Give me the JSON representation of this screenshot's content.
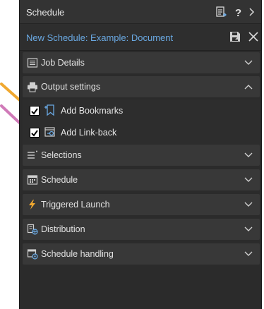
{
  "header": {
    "title": "Schedule"
  },
  "schedule": {
    "name": "New Schedule: Example: Document"
  },
  "sections": [
    {
      "label": "Job Details",
      "expanded": false,
      "icon": "list-icon"
    },
    {
      "label": "Output settings",
      "expanded": true,
      "icon": "printer-icon"
    },
    {
      "label": "Selections",
      "expanded": false,
      "icon": "selection-list-icon"
    },
    {
      "label": "Schedule",
      "expanded": false,
      "icon": "calendar-icon"
    },
    {
      "label": "Triggered Launch",
      "expanded": false,
      "icon": "lightning-icon"
    },
    {
      "label": "Distribution",
      "expanded": false,
      "icon": "distribution-icon"
    },
    {
      "label": "Schedule handling",
      "expanded": false,
      "icon": "schedule-handling-icon"
    }
  ],
  "output_settings": {
    "options": [
      {
        "label": "Add Bookmarks",
        "checked": true,
        "icon": "bookmark-icon"
      },
      {
        "label": "Add Link-back",
        "checked": true,
        "icon": "link-back-icon"
      }
    ]
  },
  "colors": {
    "panel_bg": "#2b2b2b",
    "section_bg": "#383838",
    "accent_text": "#6aa9e3",
    "arrow_orange": "#f0a830",
    "arrow_pink": "#d07ab8"
  }
}
